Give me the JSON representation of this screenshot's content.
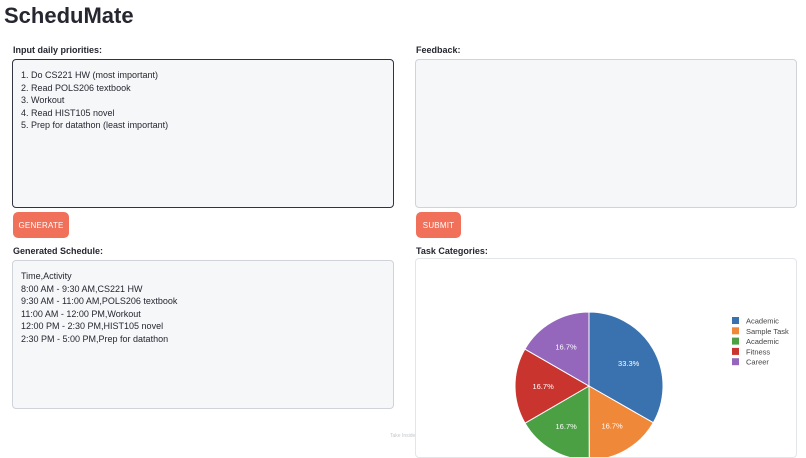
{
  "app": {
    "title": "ScheduMate"
  },
  "priorities": {
    "label": "Input daily priorities:",
    "value": "1. Do CS221 HW (most important)\n2. Read POLS206 textbook\n3. Workout\n4. Read HIST105 novel\n5. Prep for datathon (least important)"
  },
  "feedback": {
    "label": "Feedback:",
    "value": ""
  },
  "buttons": {
    "generate": "GENERATE",
    "submit": "SUBMIT"
  },
  "schedule": {
    "label": "Generated Schedule:",
    "value": "Time,Activity\n8:00 AM - 9:30 AM,CS221 HW\n9:30 AM - 11:00 AM,POLS206 textbook\n11:00 AM - 12:00 PM,Workout\n12:00 PM - 2:30 PM,HIST105 novel\n2:30 PM - 5:00 PM,Prep for datathon"
  },
  "categories": {
    "label": "Task Categories:"
  },
  "chart_data": {
    "type": "pie",
    "labels": [
      "Academic",
      "Sample Task",
      "Academic",
      "Fitness",
      "Career"
    ],
    "values": [
      33.3,
      16.7,
      16.7,
      16.7,
      16.7
    ],
    "slice_labels": [
      "33.3%",
      "16.7%",
      "16.7%",
      "16.7%",
      "16.7%"
    ],
    "colors": [
      "#3a72b0",
      "#f0883a",
      "#4aa043",
      "#c9352e",
      "#9467bd"
    ],
    "legend_position": "right"
  },
  "footer": {
    "text": "Take Inside"
  }
}
